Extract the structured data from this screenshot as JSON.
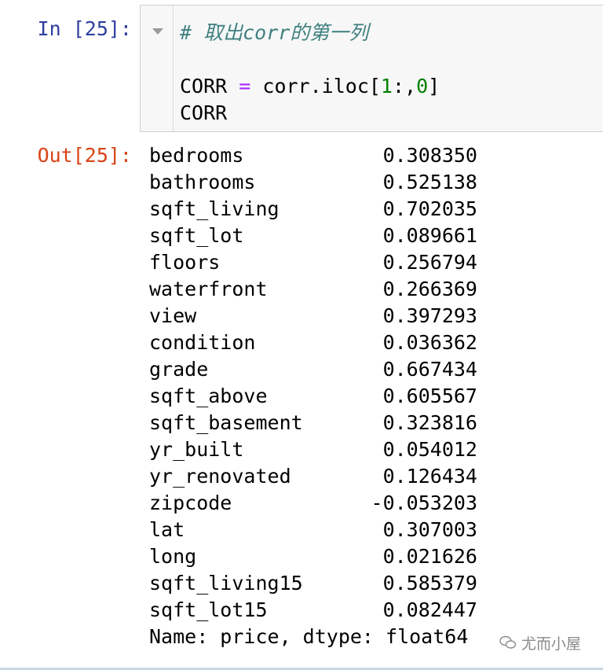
{
  "input_prompt": "In [25]:",
  "output_prompt": "Out[25]:",
  "code": {
    "comment": "# 取出corr的第一列",
    "line2": {
      "var": "CORR",
      "op": "=",
      "expr_start": "corr.iloc[",
      "num1": "1",
      "slice": ":,",
      "num2": "0",
      "end": "]"
    },
    "line3": "CORR"
  },
  "series": [
    {
      "label": "bedrooms",
      "value": "0.308350"
    },
    {
      "label": "bathrooms",
      "value": "0.525138"
    },
    {
      "label": "sqft_living",
      "value": "0.702035"
    },
    {
      "label": "sqft_lot",
      "value": "0.089661"
    },
    {
      "label": "floors",
      "value": "0.256794"
    },
    {
      "label": "waterfront",
      "value": "0.266369"
    },
    {
      "label": "view",
      "value": "0.397293"
    },
    {
      "label": "condition",
      "value": "0.036362"
    },
    {
      "label": "grade",
      "value": "0.667434"
    },
    {
      "label": "sqft_above",
      "value": "0.605567"
    },
    {
      "label": "sqft_basement",
      "value": "0.323816"
    },
    {
      "label": "yr_built",
      "value": "0.054012"
    },
    {
      "label": "yr_renovated",
      "value": "0.126434"
    },
    {
      "label": "zipcode",
      "value": "-0.053203"
    },
    {
      "label": "lat",
      "value": "0.307003"
    },
    {
      "label": "long",
      "value": "0.021626"
    },
    {
      "label": "sqft_living15",
      "value": "0.585379"
    },
    {
      "label": "sqft_lot15",
      "value": "0.082447"
    }
  ],
  "footer": "Name: price, dtype: float64",
  "watermark": "尤而小屋",
  "colors": {
    "in_prompt": "#303f9f",
    "out_prompt": "#d84315",
    "comment": "#408080",
    "operator": "#aa22ff",
    "number": "#008000"
  }
}
